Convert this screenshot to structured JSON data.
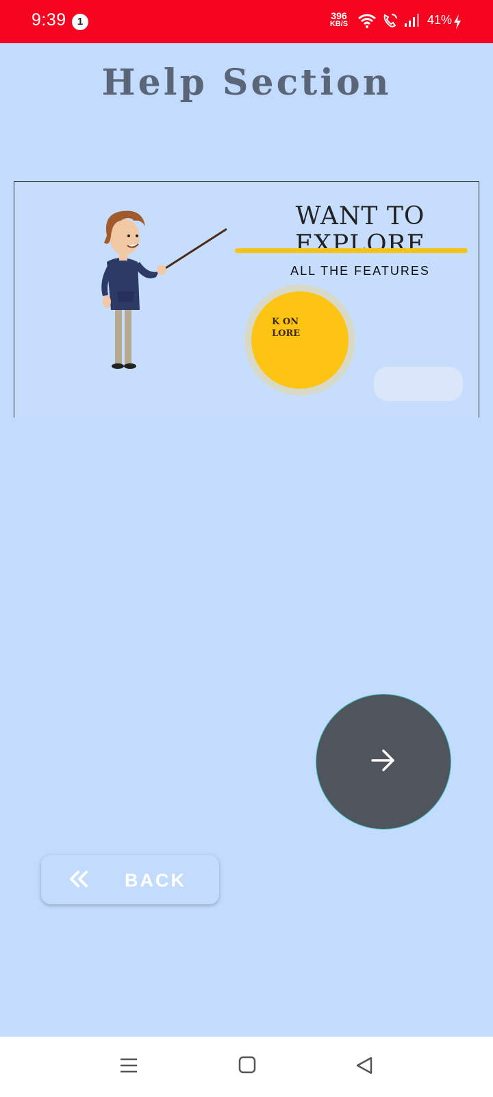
{
  "status_bar": {
    "time": "9:39",
    "notification_count": "1",
    "net_speed_value": "396",
    "net_speed_unit": "KB/S",
    "battery": "41%"
  },
  "page": {
    "title": "Help Section"
  },
  "banner": {
    "heading": "WANT TO EXPLORE",
    "subheading": "ALL THE FEATURES",
    "sun_line1": "K ON",
    "sun_line2": "LORE"
  },
  "next_button": {
    "icon": "arrow-right-icon"
  },
  "back_button": {
    "label": "BACK",
    "icon": "double-chevron-left-icon"
  },
  "nav_bar": {
    "items": [
      "menu-icon",
      "home-icon",
      "back-triangle-icon"
    ]
  },
  "colors": {
    "status_bar": "#f5051f",
    "background": "#c3dcfd",
    "title": "#5a6678",
    "accent_yellow": "#fdc413",
    "fab": "#50545c"
  }
}
